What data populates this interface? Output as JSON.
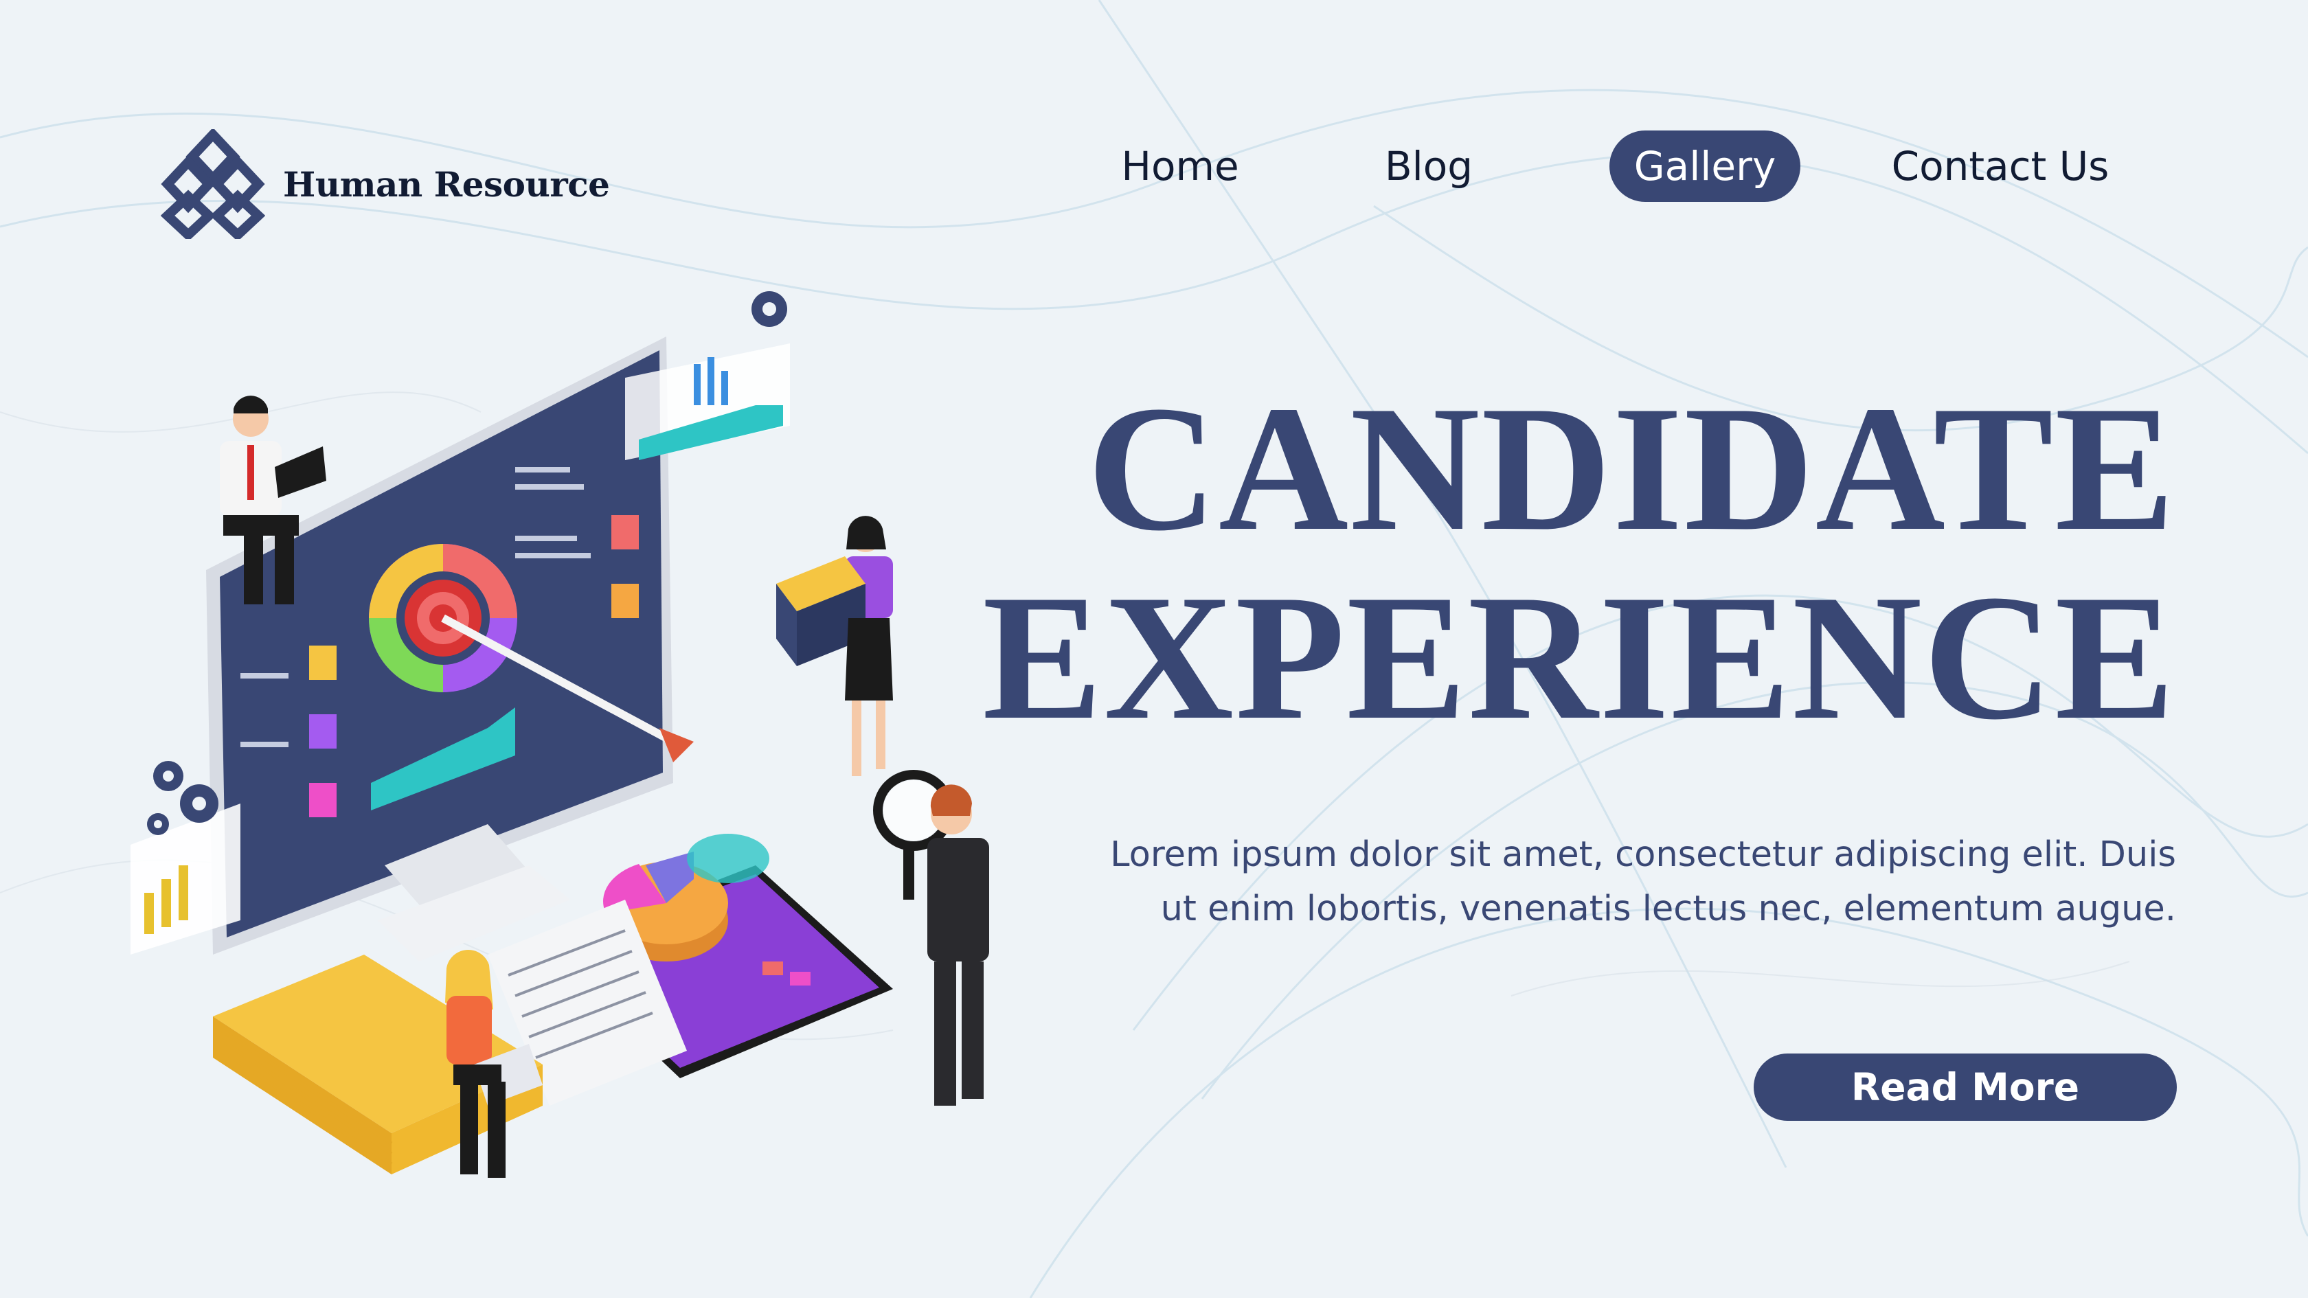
{
  "brand": {
    "name": "Human Resource",
    "logo_icon": "stacked-diamonds-icon",
    "color": "#394774"
  },
  "nav": {
    "items": [
      {
        "label": "Home",
        "active": false
      },
      {
        "label": "Blog",
        "active": false
      },
      {
        "label": "Gallery",
        "active": true
      },
      {
        "label": "Contact Us",
        "active": false
      }
    ]
  },
  "hero": {
    "title_line1": "CANDIDATE",
    "title_line2": "EXPERIENCE",
    "description": "Lorem ipsum dolor sit amet, consectetur adipiscing elit. Duis ut enim lobortis, venenatis lectus nec, elementum augue.",
    "cta_label": "Read More"
  },
  "theme": {
    "accent": "#394774",
    "background": "#eef3f7",
    "text_dark": "#111b33"
  },
  "illustration": {
    "icon": "hr-analytics-illustration"
  }
}
